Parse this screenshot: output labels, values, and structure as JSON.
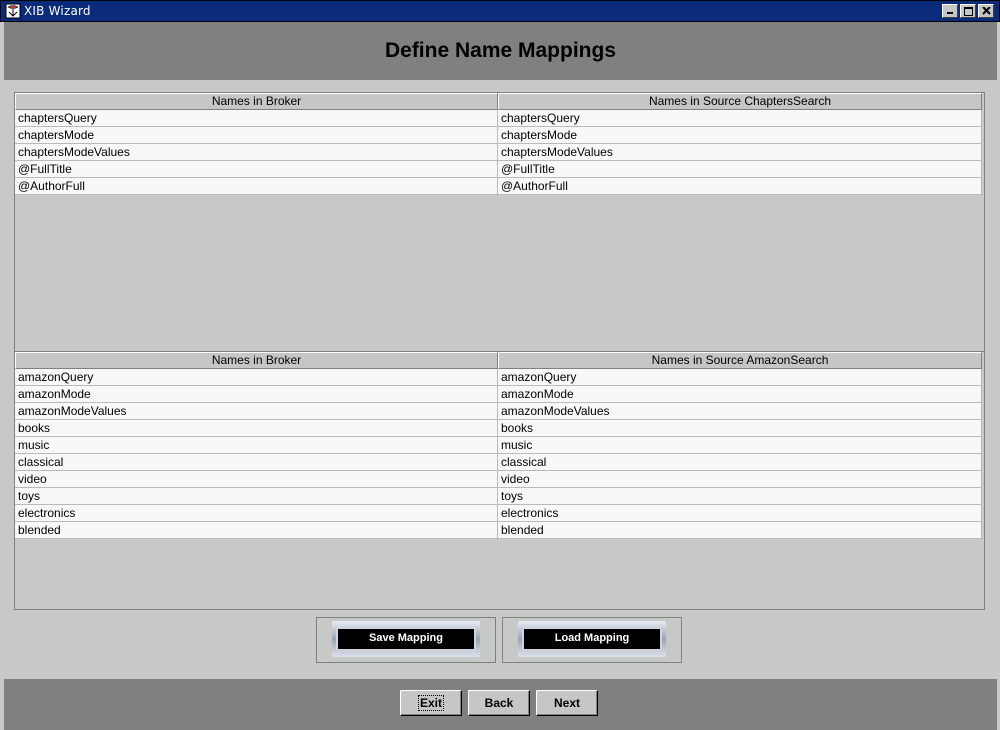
{
  "window": {
    "title": "XIB Wizard"
  },
  "header": {
    "title": "Define Name Mappings"
  },
  "table1": {
    "columns": [
      "Names in Broker",
      "Names in Source ChaptersSearch"
    ],
    "rows": [
      [
        "chaptersQuery",
        "chaptersQuery"
      ],
      [
        "chaptersMode",
        "chaptersMode"
      ],
      [
        "chaptersModeValues",
        "chaptersModeValues"
      ],
      [
        "@FullTitle",
        "@FullTitle"
      ],
      [
        "@AuthorFull",
        "@AuthorFull"
      ]
    ]
  },
  "table2": {
    "columns": [
      "Names in Broker",
      "Names in Source AmazonSearch"
    ],
    "rows": [
      [
        "amazonQuery",
        "amazonQuery"
      ],
      [
        "amazonMode",
        "amazonMode"
      ],
      [
        "amazonModeValues",
        "amazonModeValues"
      ],
      [
        "books",
        "books"
      ],
      [
        "music",
        "music"
      ],
      [
        "classical",
        "classical"
      ],
      [
        "video",
        "video"
      ],
      [
        "toys",
        "toys"
      ],
      [
        "electronics",
        "electronics"
      ],
      [
        "blended",
        "blended"
      ]
    ]
  },
  "mapping_buttons": {
    "save_label": "Save Mapping",
    "load_label": "Load Mapping"
  },
  "nav": {
    "exit_label": "Exit",
    "back_label": "Back",
    "next_label": "Next"
  },
  "colors": {
    "titlebar": "#0a2a7a",
    "band": "#808080",
    "panel": "#c6c9c6",
    "cell": "#f6f9f6"
  }
}
